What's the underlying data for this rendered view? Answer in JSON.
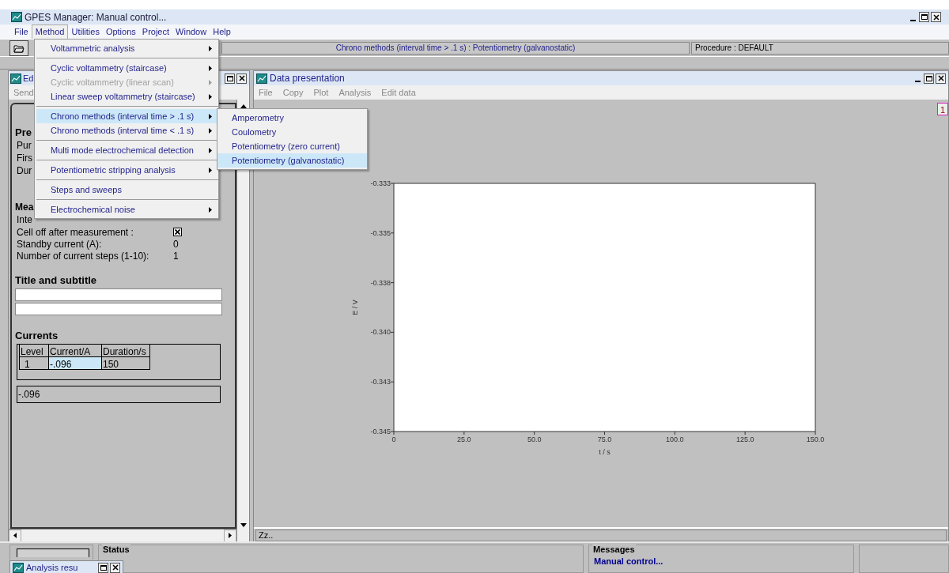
{
  "window": {
    "title": "GPES Manager: Manual control..."
  },
  "menubar": [
    {
      "label": "File",
      "selected": false
    },
    {
      "label": "Method",
      "selected": true
    },
    {
      "label": "Utilities",
      "selected": false
    },
    {
      "label": "Options",
      "selected": false
    },
    {
      "label": "Project",
      "selected": false
    },
    {
      "label": "Window",
      "selected": false
    },
    {
      "label": "Help",
      "selected": false
    }
  ],
  "toolbar": {
    "method_status": "Chrono methods (interval time > .1 s) : Potentiometry (galvanostatic)",
    "procedure": "Procedure : DEFAULT"
  },
  "method_menu": [
    [
      {
        "label": "Voltammetric analysis",
        "submenu": true,
        "disabled": false,
        "selected": false
      }
    ],
    [
      {
        "label": "Cyclic voltammetry (staircase)",
        "submenu": true,
        "disabled": false,
        "selected": false
      },
      {
        "label": "Cyclic voltammetry (linear scan)",
        "submenu": true,
        "disabled": true,
        "selected": false
      },
      {
        "label": "Linear sweep voltammetry (staircase)",
        "submenu": true,
        "disabled": false,
        "selected": false
      }
    ],
    [
      {
        "label": "Chrono methods (interval time > .1 s)",
        "submenu": true,
        "disabled": false,
        "selected": true
      },
      {
        "label": "Chrono methods (interval time < .1 s)",
        "submenu": true,
        "disabled": false,
        "selected": false
      }
    ],
    [
      {
        "label": "Multi mode electrochemical detection",
        "submenu": true,
        "disabled": false,
        "selected": false
      }
    ],
    [
      {
        "label": "Potentiometric stripping analysis",
        "submenu": true,
        "disabled": false,
        "selected": false
      }
    ],
    [
      {
        "label": "Steps and sweeps",
        "submenu": false,
        "disabled": false,
        "selected": false
      }
    ],
    [
      {
        "label": "Electrochemical noise",
        "submenu": true,
        "disabled": false,
        "selected": false
      }
    ]
  ],
  "submenu": [
    {
      "label": "Amperometry",
      "selected": false
    },
    {
      "label": "Coulometry",
      "selected": false
    },
    {
      "label": "Potentiometry (zero current)",
      "selected": false
    },
    {
      "label": "Potentiometry (galvanostatic)",
      "selected": true
    }
  ],
  "editor": {
    "title": "Ed",
    "menu": "Send",
    "section_1": {
      "heading": "Pre",
      "lines": [
        "Pur",
        "Firs",
        "Dur"
      ]
    },
    "section_2": {
      "heading": "Mea",
      "lines": [
        "Inte"
      ]
    },
    "params": [
      {
        "kind": "checkbox",
        "label": "Cell off after measurement :",
        "checked": true
      },
      {
        "kind": "value",
        "label": "Standby current (A):",
        "value": "0"
      },
      {
        "kind": "value",
        "label": "Number of current steps (1-10):",
        "value": "1"
      }
    ],
    "title_heading": "Title and subtitle",
    "currents_heading": "Currents",
    "table": {
      "columns": [
        "Level",
        "Current/A",
        "Duration/s"
      ],
      "rows": [
        [
          {
            "text": "1",
            "selected": false
          },
          {
            "text": "-.096",
            "selected": true
          },
          {
            "text": "150",
            "selected": false
          }
        ]
      ]
    },
    "edit_value": "-.096"
  },
  "data_presentation": {
    "title": "Data presentation",
    "menu": [
      "File",
      "Copy",
      "Plot",
      "Analysis",
      "Edit data"
    ],
    "badge": "1",
    "status": "Zz..",
    "chart_data": {
      "type": "line",
      "xlabel": "t / s",
      "ylabel": "E / V",
      "xlim": [
        0,
        150
      ],
      "ylim": [
        -0.345,
        -0.333
      ],
      "xticks": [
        {
          "value": 0,
          "label": "0"
        },
        {
          "value": 25,
          "label": "25.0"
        },
        {
          "value": 50,
          "label": "50.0"
        },
        {
          "value": 75,
          "label": "75.0"
        },
        {
          "value": 100,
          "label": "100.0"
        },
        {
          "value": 125,
          "label": "125.0"
        },
        {
          "value": 150,
          "label": "150.0"
        }
      ],
      "yticks": [
        {
          "value": -0.333,
          "label": "-0.333"
        },
        {
          "value": -0.3354,
          "label": "-0.335"
        },
        {
          "value": -0.3378,
          "label": "-0.338"
        },
        {
          "value": -0.3402,
          "label": "-0.340"
        },
        {
          "value": -0.3426,
          "label": "-0.343"
        },
        {
          "value": -0.345,
          "label": "-0.345"
        }
      ]
    }
  },
  "bottom": {
    "status_heading": "Status",
    "messages_heading": "Messages",
    "message": "Manual control...",
    "minimized_window": "Analysis resu"
  }
}
